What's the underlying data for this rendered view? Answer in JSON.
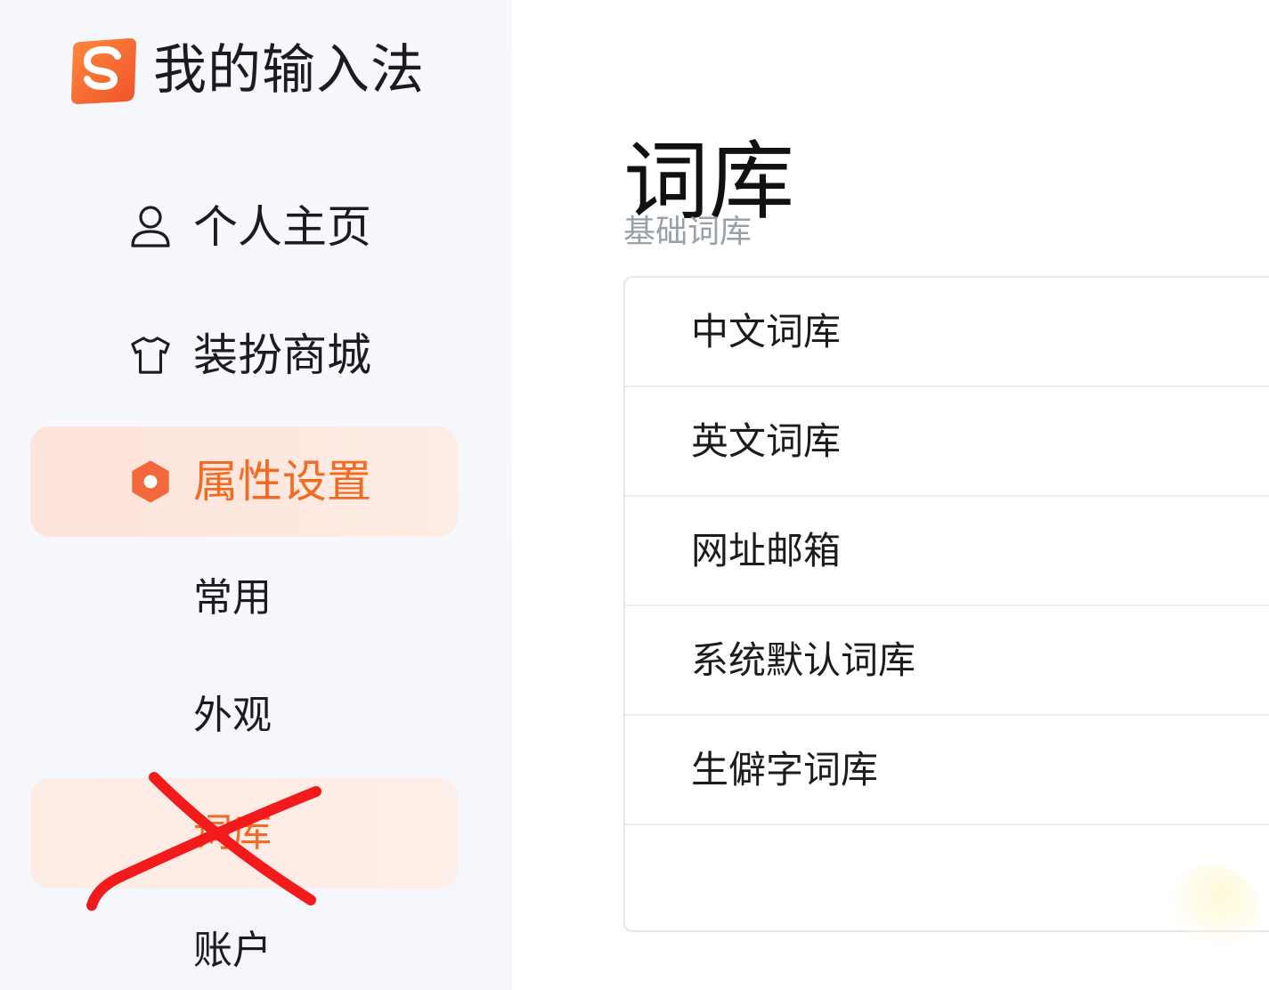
{
  "app": {
    "title": "我的输入法",
    "accent_color": "#f36b23"
  },
  "sidebar": {
    "items": [
      {
        "label": "个人主页",
        "icon": "user-icon"
      },
      {
        "label": "装扮商城",
        "icon": "shirt-icon"
      },
      {
        "label": "属性设置",
        "icon": "settings-hexagon-icon",
        "active": true
      }
    ],
    "sub_items": [
      {
        "label": "常用"
      },
      {
        "label": "外观"
      },
      {
        "label": "词库",
        "selected": true,
        "crossed_out": true
      },
      {
        "label": "账户"
      }
    ]
  },
  "main": {
    "title": "词库",
    "section_label": "基础词库",
    "rows": [
      {
        "label": "中文词库"
      },
      {
        "label": "英文词库"
      },
      {
        "label": "网址邮箱"
      },
      {
        "label": "系统默认词库"
      },
      {
        "label": "生僻字词库"
      }
    ]
  }
}
